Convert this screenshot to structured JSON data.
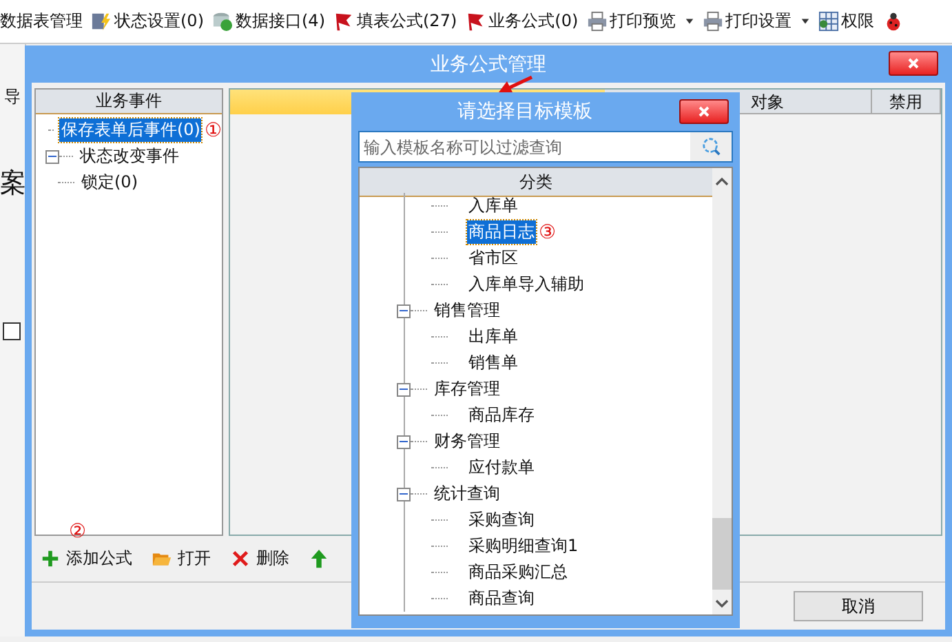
{
  "toolbar": {
    "items": [
      {
        "label": "数据表管理",
        "kind": "none",
        "dropdown": false
      },
      {
        "label": "状态设置(0)",
        "kind": "bolt",
        "dropdown": false
      },
      {
        "label": "数据接口(4)",
        "kind": "sync",
        "dropdown": false
      },
      {
        "label": "填表公式(27)",
        "kind": "flag",
        "dropdown": false
      },
      {
        "label": "业务公式(0)",
        "kind": "flag",
        "dropdown": false
      },
      {
        "label": "打印预览",
        "kind": "printer",
        "dropdown": true
      },
      {
        "label": "打印设置",
        "kind": "printer",
        "dropdown": true
      },
      {
        "label": "权限",
        "kind": "grid",
        "dropdown": false
      },
      {
        "kind": "bug",
        "dropdown": false
      }
    ]
  },
  "background_app": {
    "labels": [
      "导",
      "案"
    ],
    "checkbox": {
      "checked": false
    }
  },
  "dialog": {
    "title": "业务公式管理",
    "events_panel": {
      "header": "业务事件",
      "tree": [
        {
          "label": "保存表单后事件(0)",
          "selected": true,
          "marker": "①"
        },
        {
          "label": "状态改变事件",
          "selected": false,
          "expanded": true,
          "children": [
            {
              "label": "锁定(0)",
              "selected": false
            }
          ]
        }
      ]
    },
    "formula_table": {
      "columns": [
        "对象",
        "禁用"
      ]
    },
    "toolbar": {
      "marker": "②",
      "items": [
        {
          "label": "添加公式",
          "kind": "add"
        },
        {
          "label": "打开",
          "kind": "open"
        },
        {
          "label": "删除",
          "kind": "delete"
        },
        {
          "kind": "up"
        }
      ]
    },
    "buttons": [
      "取消"
    ]
  },
  "picker": {
    "title": "请选择目标模板",
    "search": {
      "placeholder": "输入模板名称可以过滤查询"
    },
    "column": "分类",
    "groups": [
      {
        "children": [
          {
            "label": "入库单",
            "selected": false
          },
          {
            "label": "商品日志",
            "selected": true,
            "marker": "③"
          },
          {
            "label": "省市区",
            "selected": false
          },
          {
            "label": "入库单导入辅助",
            "selected": false
          }
        ]
      },
      {
        "label": "销售管理",
        "expanded": true,
        "children": [
          {
            "label": "出库单",
            "selected": false
          },
          {
            "label": "销售单",
            "selected": false
          }
        ]
      },
      {
        "label": "库存管理",
        "expanded": true,
        "children": [
          {
            "label": "商品库存",
            "selected": false
          }
        ]
      },
      {
        "label": "财务管理",
        "expanded": true,
        "children": [
          {
            "label": "应付款单",
            "selected": false
          }
        ]
      },
      {
        "label": "统计查询",
        "expanded": true,
        "children": [
          {
            "label": "采购查询",
            "selected": false
          },
          {
            "label": "采购明细查询1",
            "selected": false
          },
          {
            "label": "商品采购汇总",
            "selected": false
          },
          {
            "label": "商品查询",
            "selected": false
          }
        ]
      }
    ]
  }
}
